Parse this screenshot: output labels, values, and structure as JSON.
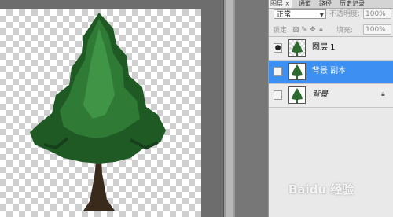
{
  "panel": {
    "tabs": [
      "图层 ×",
      "通道",
      "路径",
      "历史记录"
    ],
    "blend_mode": "正常",
    "opacity_label": "不透明度:",
    "opacity_value": "100%",
    "lock_label": "锁定:",
    "fill_label": "填充:",
    "fill_value": "100%",
    "layers": [
      {
        "name": "图层 1",
        "visible": true,
        "selected": false,
        "locked": false
      },
      {
        "name": "背景 副本",
        "visible": false,
        "selected": true,
        "locked": false
      },
      {
        "name": "背景",
        "visible": false,
        "selected": false,
        "locked": true
      }
    ]
  },
  "icons": {
    "eye": "eye-icon",
    "lock": "lock-icon",
    "move": "move-icon",
    "brush": "brush-icon"
  },
  "watermark": "Baidu 经验",
  "colors": {
    "selection": "#3d8ff2",
    "canvas_bg": "#6d6d6d",
    "panel_bg": "#e9e9e9"
  }
}
